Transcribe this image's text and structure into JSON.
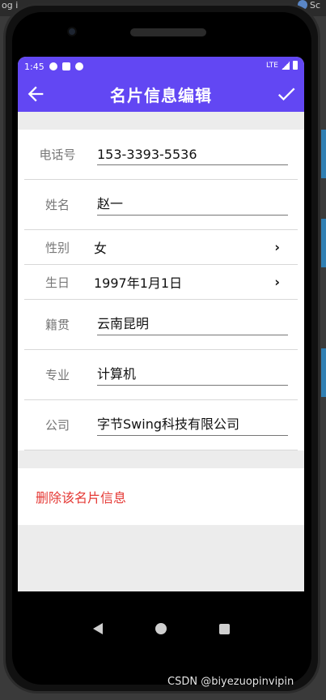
{
  "ide": {
    "left_fragment": "og i",
    "right_fragment": "Sc"
  },
  "status": {
    "time": "1:45",
    "network": "LTE"
  },
  "appbar": {
    "title": "名片信息编辑"
  },
  "form": {
    "phone": {
      "label": "电话号",
      "value": "153-3393-5536"
    },
    "name": {
      "label": "姓名",
      "value": "赵一"
    },
    "gender": {
      "label": "性别",
      "value": "女"
    },
    "birthday": {
      "label": "生日",
      "value": "1997年1月1日"
    },
    "hometown": {
      "label": "籍贯",
      "value": "云南昆明"
    },
    "major": {
      "label": "专业",
      "value": "计算机"
    },
    "company": {
      "label": "公司",
      "value": "字节Swing科技有限公司"
    }
  },
  "actions": {
    "delete_label": "删除该名片信息"
  },
  "watermark": "CSDN @biyezuopinvipin",
  "colors": {
    "primary": "#6247f3",
    "danger": "#e53935"
  }
}
